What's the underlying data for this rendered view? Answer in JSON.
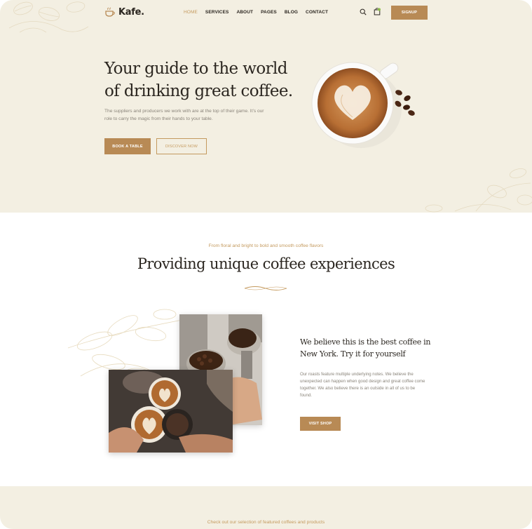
{
  "header": {
    "logo_text": "Kafe.",
    "nav": [
      {
        "label": "HOME",
        "active": true
      },
      {
        "label": "SERVICES"
      },
      {
        "label": "ABOUT"
      },
      {
        "label": "PAGES"
      },
      {
        "label": "BLOG"
      },
      {
        "label": "CONTACT"
      }
    ],
    "signup_label": "SIGNUP"
  },
  "hero": {
    "title_line1": "Your guide to the world",
    "title_line2": "of drinking great coffee.",
    "description": "The suppliers and producers we work with are at the top of their game. It’s our role to carry the magic from their hands to your table.",
    "primary_button": "BOOK A TABLE",
    "secondary_button": "DISCOVER NOW"
  },
  "experience": {
    "eyebrow": "From floral and bright to bold and smooth coffee flavors",
    "title": "Providing unique coffee experiences",
    "feature_heading": "We believe this is the best coffee in New York. Try it for yourself",
    "feature_text": "Our roasts feature multiple underlying notes. We believe the unexpected can happen when good design and great coffee come together. We also believe there is an outside in all of us to be found.",
    "cta": "VISIT SHOP"
  },
  "featured": {
    "eyebrow": "Check out our selection of featured coffees and products"
  },
  "colors": {
    "accent": "#b88a55",
    "accent_text": "#c49a5e",
    "cream": "#f3efe2",
    "heading": "#2b2620",
    "muted": "#8a847a"
  },
  "icons": [
    "logo-cup-icon",
    "search-icon",
    "cart-icon"
  ]
}
